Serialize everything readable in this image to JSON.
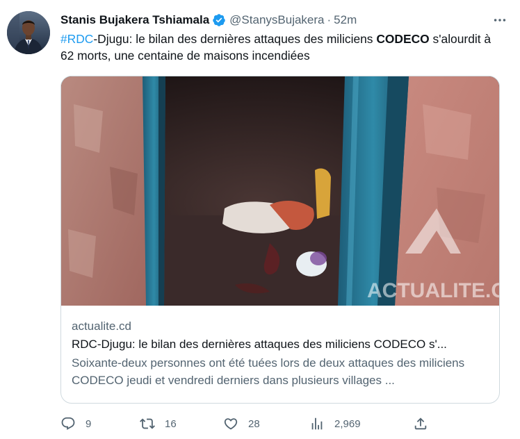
{
  "tweet": {
    "author_name": "Stanis Bujakera Tshiamala",
    "handle": "@StanysBujakera",
    "separator": "·",
    "time": "52m",
    "text": {
      "hashtag": "#RDC",
      "part1": "-Djugu: le bilan des dernières attaques des miliciens ",
      "bold": "CODECO",
      "part2": " s'alourdit à 62 morts, une centaine de maisons incendiées"
    },
    "card": {
      "domain": "actualite.cd",
      "title": "RDC-Djugu: le bilan des dernières attaques des miliciens CODECO s'...",
      "description": "Soixante-deux personnes ont été tuées lors de deux attaques des miliciens CODECO jeudi et vendredi derniers dans plusieurs villages ...",
      "image_watermark": "ACTUALITE.CD"
    },
    "actions": {
      "replies": "9",
      "retweets": "16",
      "likes": "28",
      "views": "2,969"
    }
  },
  "colors": {
    "link": "#1d9bf0",
    "secondary_text": "#536471",
    "primary_text": "#0f1419",
    "border": "#cfd9de",
    "verified": "#1d9bf0"
  },
  "icons": [
    "verified-badge-icon",
    "more-icon",
    "reply-icon",
    "retweet-icon",
    "like-icon",
    "views-icon",
    "share-icon"
  ]
}
